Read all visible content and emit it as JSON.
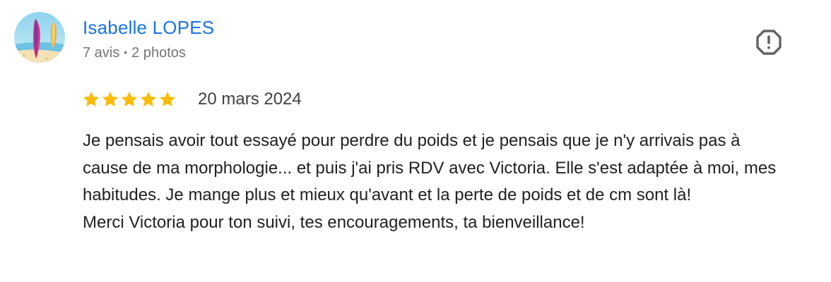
{
  "author": {
    "name": "Isabelle LOPES",
    "reviews_count": "7 avis",
    "separator": "•",
    "photos_count": "2 photos",
    "avatar_icon": "surfboard-beach-avatar"
  },
  "report": {
    "icon": "report-octagon-icon"
  },
  "rating": {
    "stars": 5,
    "max": 5,
    "star_color": "#fbbc04"
  },
  "review": {
    "date": "20 mars 2024",
    "paragraphs": [
      "Je pensais avoir tout essayé pour perdre du poids et je pensais que je n'y arrivais pas à cause de ma morphologie... et puis j'ai pris RDV avec Victoria. Elle s'est adaptée à moi, mes habitudes. Je mange plus et mieux qu'avant et la perte de poids et de cm sont là!",
      "Merci Victoria pour ton suivi, tes encouragements, ta bienveillance!"
    ]
  },
  "colors": {
    "name_link": "#1a73e8",
    "meta_text": "#70757a",
    "body_text": "#202124"
  }
}
